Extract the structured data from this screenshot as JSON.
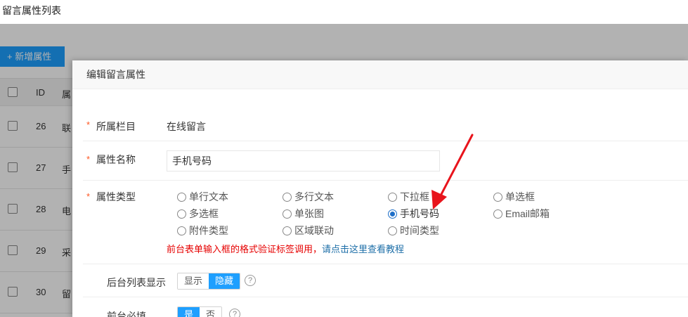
{
  "page": {
    "title": "留言属性列表"
  },
  "toolbar": {
    "add_label": "+ 新增属性"
  },
  "bg_table": {
    "header": {
      "id": "ID",
      "name": "属"
    },
    "rows": [
      {
        "id": "26",
        "name": "联"
      },
      {
        "id": "27",
        "name": "手"
      },
      {
        "id": "28",
        "name": "电"
      },
      {
        "id": "29",
        "name": "采"
      },
      {
        "id": "30",
        "name": "留"
      }
    ]
  },
  "dialog": {
    "title": "编辑留言属性",
    "column": {
      "label": "所属栏目",
      "value": "在线留言"
    },
    "attr_name": {
      "label": "属性名称",
      "value": "手机号码"
    },
    "attr_type": {
      "label": "属性类型",
      "options": [
        "单行文本",
        "多行文本",
        "下拉框",
        "单选框",
        "多选框",
        "单张图",
        "手机号码",
        "Email邮箱",
        "附件类型",
        "区域联动",
        "时间类型"
      ],
      "selected": "手机号码"
    },
    "hint": {
      "text": "前台表单输入框的格式验证标签调用，",
      "link": "请点击这里查看教程"
    },
    "list_display": {
      "label": "后台列表显示",
      "options": [
        "显示",
        "隐藏"
      ],
      "selected": "隐藏"
    },
    "required": {
      "label": "前台必填",
      "options": [
        "是",
        "否"
      ],
      "selected": "是"
    },
    "required_star": "*",
    "help_glyph": "?"
  },
  "colors": {
    "accent": "#1e9fff",
    "required": "#ff5722",
    "hint_red": "#e60000",
    "arrow": "#e8141c"
  }
}
